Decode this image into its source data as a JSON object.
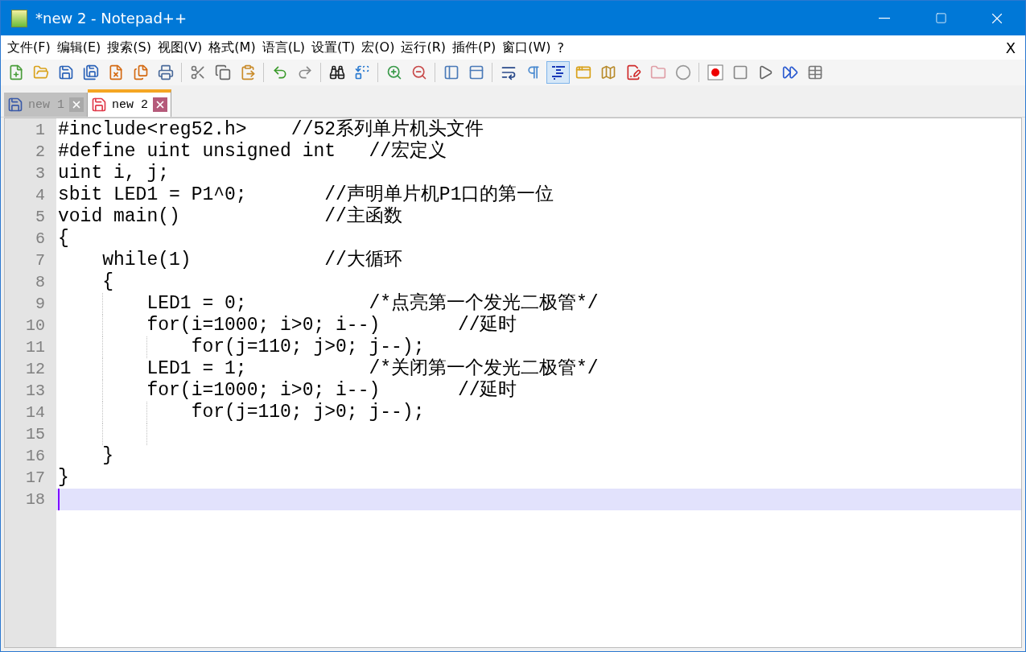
{
  "window": {
    "title": "*new 2 - Notepad++"
  },
  "menu": [
    "文件(F)",
    "编辑(E)",
    "搜索(S)",
    "视图(V)",
    "格式(M)",
    "语言(L)",
    "设置(T)",
    "宏(O)",
    "运行(R)",
    "插件(P)",
    "窗口(W)",
    "?"
  ],
  "menu_close": "X",
  "toolbar": {
    "indent_guides_shown": true
  },
  "tabs": [
    {
      "label": "new 1",
      "selected": false,
      "modified": false
    },
    {
      "label": "new 2",
      "selected": true,
      "modified": true
    }
  ],
  "editor": {
    "lines": [
      {
        "number": "1",
        "text": "#include<reg52.h>    //52系列单片机头文件",
        "current": false
      },
      {
        "number": "2",
        "text": "#define uint unsigned int   //宏定义",
        "current": false
      },
      {
        "number": "3",
        "text": "uint i, j;",
        "current": false
      },
      {
        "number": "4",
        "text": "sbit LED1 = P1^0;       //声明单片机P1口的第一位",
        "current": false
      },
      {
        "number": "5",
        "text": "void main()             //主函数",
        "current": false
      },
      {
        "number": "6",
        "text": "{",
        "current": false
      },
      {
        "number": "7",
        "text": "    while(1)            //大循环",
        "current": false
      },
      {
        "number": "8",
        "text": "    {",
        "current": false
      },
      {
        "number": "9",
        "text": "        LED1 = 0;           /*点亮第一个发光二极管*/",
        "current": false
      },
      {
        "number": "10",
        "text": "        for(i=1000; i>0; i--)       //延时",
        "current": false
      },
      {
        "number": "11",
        "text": "            for(j=110; j>0; j--);",
        "current": false
      },
      {
        "number": "12",
        "text": "        LED1 = 1;           /*关闭第一个发光二极管*/",
        "current": false
      },
      {
        "number": "13",
        "text": "        for(i=1000; i>0; i--)       //延时",
        "current": false
      },
      {
        "number": "14",
        "text": "            for(j=110; j>0; j--);",
        "current": false
      },
      {
        "number": "15",
        "current": false
      },
      {
        "number": "16",
        "text": "    }",
        "current": false
      },
      {
        "number": "17",
        "text": "}",
        "current": false
      },
      {
        "number": "18",
        "current": true
      }
    ]
  }
}
